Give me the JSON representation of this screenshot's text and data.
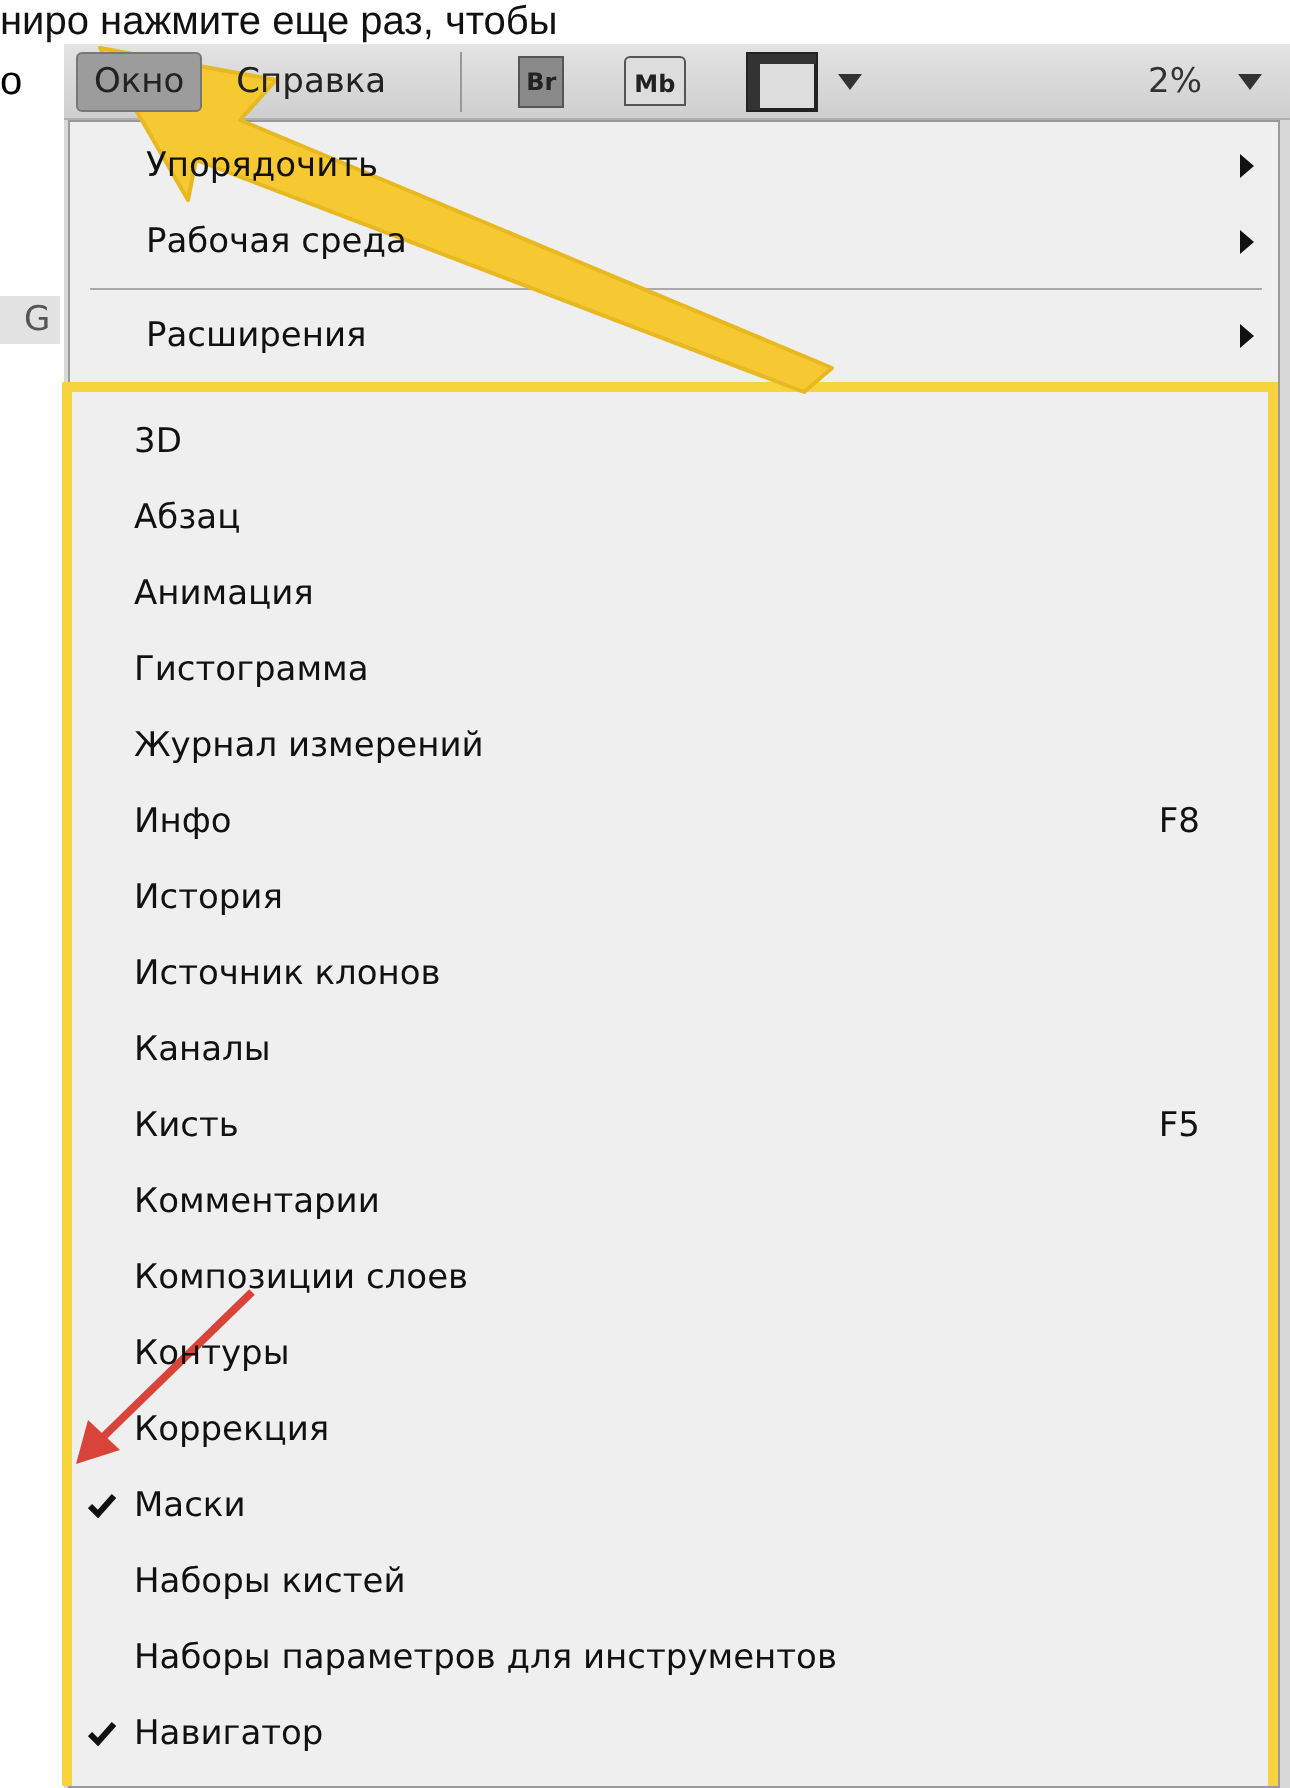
{
  "caption": {
    "lines": [
      "ниро нажмите еще раз, чтобы",
      "о"
    ]
  },
  "side_fragment": "G",
  "menubar": {
    "menus": [
      {
        "label": "Окно",
        "selected": true
      },
      {
        "label": "Справка",
        "selected": false
      }
    ],
    "toolbar": [
      {
        "kind": "badge",
        "label": "Br"
      },
      {
        "kind": "folder",
        "label": "Mb"
      },
      {
        "kind": "frame"
      }
    ],
    "zoom": "2%"
  },
  "menu": {
    "top_items": [
      {
        "kind": "item",
        "label": "Упорядочить",
        "submenu": true
      },
      {
        "kind": "item",
        "label": "Рабочая среда",
        "submenu": true
      },
      {
        "kind": "separator"
      },
      {
        "kind": "item",
        "label": "Расширения",
        "submenu": true
      }
    ],
    "panel_items": [
      {
        "label": "3D",
        "checked": false
      },
      {
        "label": "Абзац",
        "checked": false
      },
      {
        "label": "Анимация",
        "checked": false
      },
      {
        "label": "Гистограмма",
        "checked": false
      },
      {
        "label": "Журнал измерений",
        "checked": false
      },
      {
        "label": "Инфо",
        "checked": false,
        "shortcut": "F8"
      },
      {
        "label": "История",
        "checked": false
      },
      {
        "label": "Источник клонов",
        "checked": false
      },
      {
        "label": "Каналы",
        "checked": false
      },
      {
        "label": "Кисть",
        "checked": false,
        "shortcut": "F5"
      },
      {
        "label": "Комментарии",
        "checked": false
      },
      {
        "label": "Композиции слоев",
        "checked": false
      },
      {
        "label": "Контуры",
        "checked": false
      },
      {
        "label": "Коррекция",
        "checked": false
      },
      {
        "label": "Маски",
        "checked": true
      },
      {
        "label": "Наборы кистей",
        "checked": false
      },
      {
        "label": "Наборы параметров для инструментов",
        "checked": false
      },
      {
        "label": "Навигатор",
        "checked": true
      }
    ]
  }
}
